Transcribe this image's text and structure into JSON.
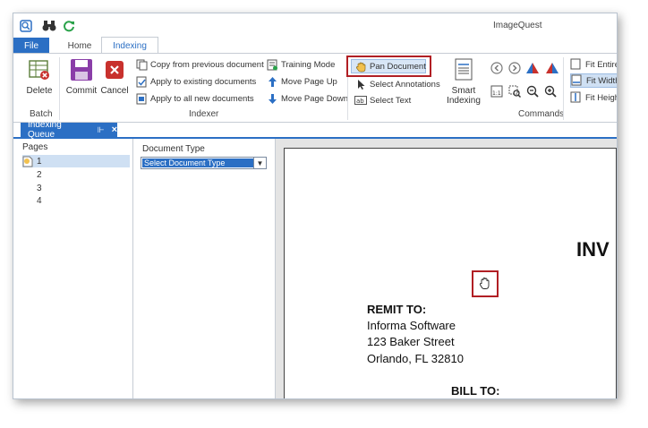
{
  "app": {
    "title": "ImageQuest"
  },
  "ribbon_tabs": {
    "file": "File",
    "home": "Home",
    "indexing": "Indexing"
  },
  "batch": {
    "label": "Batch",
    "delete": "Delete"
  },
  "indexer": {
    "label": "Indexer",
    "commit": "Commit",
    "cancel": "Cancel",
    "copy_prev": "Copy from previous document",
    "apply_existing": "Apply to existing documents",
    "apply_new": "Apply to all new documents",
    "training": "Training Mode",
    "move_up": "Move Page Up",
    "move_down": "Move Page Down"
  },
  "commands": {
    "label": "Commands",
    "pan": "Pan Document",
    "select_annotations": "Select Annotations",
    "select_text": "Select Text",
    "smart_line1": "Smart",
    "smart_line2": "Indexing",
    "fit_entire": "Fit Entire",
    "fit_width": "Fit Width",
    "fit_height": "Fit Height"
  },
  "doc_tab": {
    "label": "Indexing Queue"
  },
  "pages": {
    "label": "Pages",
    "items": [
      "1",
      "2",
      "3",
      "4"
    ]
  },
  "doc_type": {
    "label": "Document Type",
    "selected": "Select Document Type"
  },
  "document": {
    "heading": "INV",
    "remit_heading": "REMIT TO:",
    "remit_lines": [
      "Informa Software",
      "123 Baker Street",
      "Orlando, FL  32810"
    ],
    "bill_heading": "BILL TO:"
  },
  "colors": {
    "accent": "#2b6fc4",
    "highlight": "#b11f24"
  }
}
